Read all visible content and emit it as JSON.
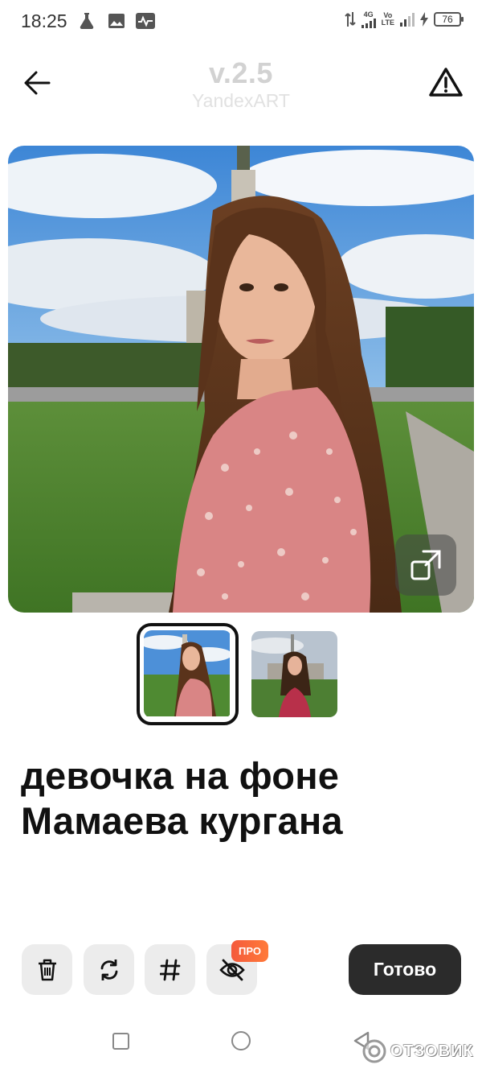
{
  "status_bar": {
    "time": "18:25",
    "network_small": "4G",
    "network_volte_top": "Vo",
    "network_volte_bottom": "LTE",
    "battery": "76"
  },
  "header": {
    "back_icon": "arrow-left-icon",
    "model_version": "v.2.5",
    "model_name": "YandexART",
    "warning_icon": "warning-triangle-icon"
  },
  "prompt": {
    "line1": "девочка на фоне",
    "line2": "Мамаева кургана"
  },
  "toolbar": {
    "delete_icon": "trash-icon",
    "regenerate_icon": "refresh-icon",
    "hashtag_icon": "hashtag-icon",
    "hide_icon": "eye-off-icon",
    "pro_badge": "ПРО",
    "done_label": "Готово"
  },
  "watermark": {
    "text": "ОТЗОВИК"
  },
  "colors": {
    "done_button_bg": "#2b2b2b",
    "pro_badge_bg": "#f45a3c",
    "tool_button_bg": "#ececec",
    "header_text": "#d2d2d2"
  }
}
